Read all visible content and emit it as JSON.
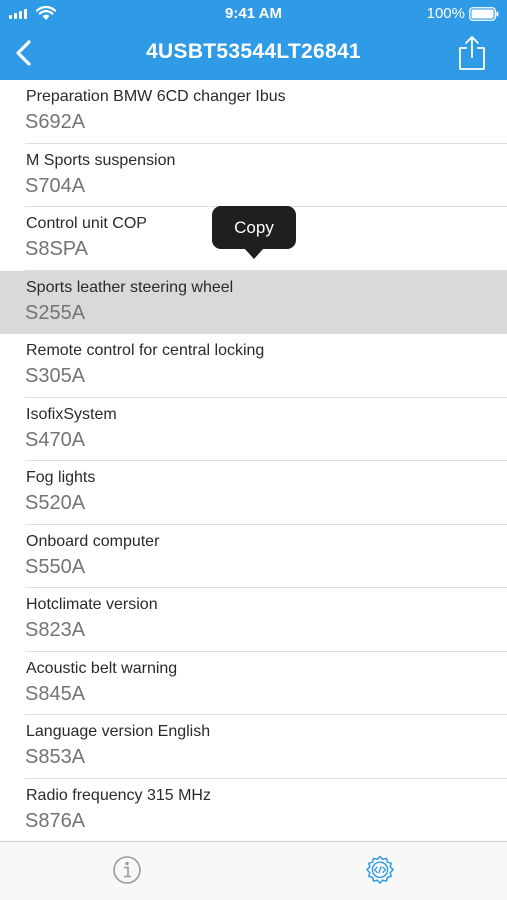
{
  "status_bar": {
    "time": "9:41 AM",
    "battery_percent": "100%",
    "signal_icon": "cellular-signal-icon",
    "wifi_icon": "wifi-icon",
    "battery_icon": "battery-icon",
    "battery_level": 1.0
  },
  "nav": {
    "title": "4USBT53544LT26841",
    "back_icon": "chevron-left-icon",
    "share_icon": "share-icon"
  },
  "colors": {
    "header_bg": "#2f9be6",
    "highlight_bg": "#d9d9d9",
    "tab_active": "#2f9be6",
    "tab_inactive": "#9a9a9a"
  },
  "options": [
    {
      "label": "Preparation BMW 6CD changer Ibus",
      "code": "S692A"
    },
    {
      "label": "M Sports suspension",
      "code": "S704A"
    },
    {
      "label": "Control unit COP",
      "code": "S8SPA"
    },
    {
      "label": "Sports leather steering wheel",
      "code": "S255A"
    },
    {
      "label": "Remote control for central locking",
      "code": "S305A"
    },
    {
      "label": "IsofixSystem",
      "code": "S470A"
    },
    {
      "label": "Fog lights",
      "code": "S520A"
    },
    {
      "label": "Onboard computer",
      "code": "S550A"
    },
    {
      "label": "Hotclimate version",
      "code": "S823A"
    },
    {
      "label": "Acoustic belt warning",
      "code": "S845A"
    },
    {
      "label": "Language version English",
      "code": "S853A"
    },
    {
      "label": "Radio frequency 315 MHz",
      "code": "S876A"
    }
  ],
  "highlighted_index": 3,
  "tooltip": {
    "label": "Copy"
  },
  "tabs": [
    {
      "icon": "info-icon",
      "active": false
    },
    {
      "icon": "gear-code-icon",
      "active": true
    }
  ]
}
